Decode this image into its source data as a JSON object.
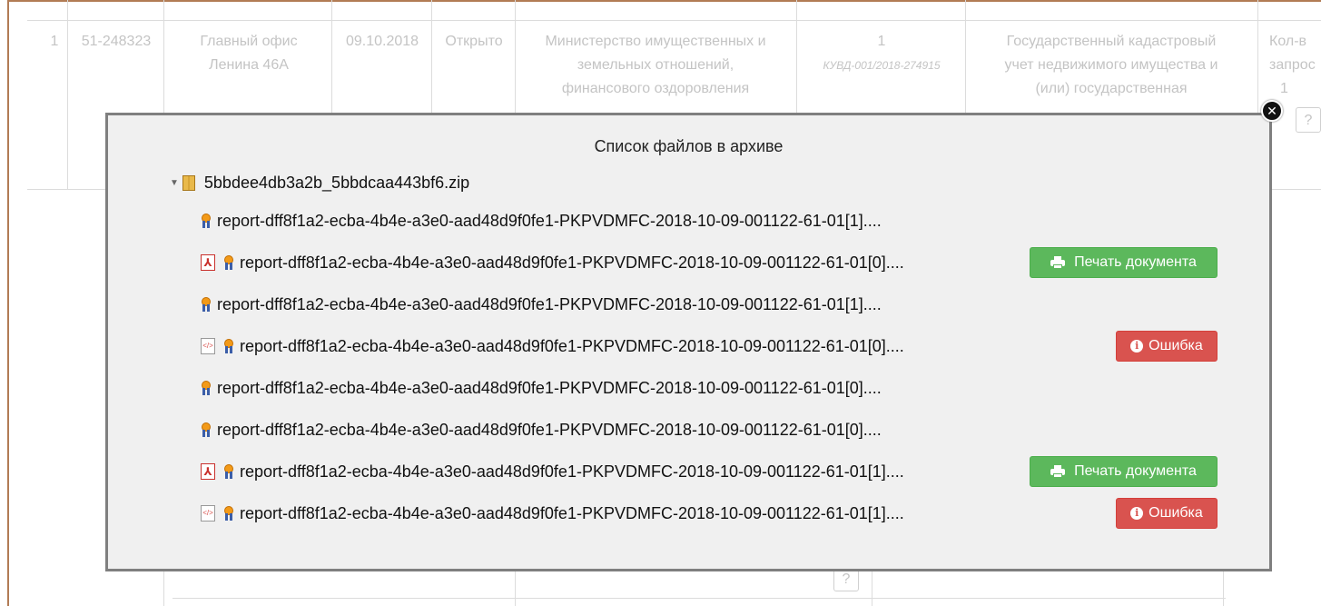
{
  "background_table": {
    "row_num": "1",
    "number": "51-248323",
    "office_line1": "Главный офис",
    "office_line2": "Ленина 46А",
    "date": "09.10.2018",
    "status": "Открыто",
    "org_line1": "Министерство имущественных и",
    "org_line2": "земельных отношений,",
    "org_line3": "финансового оздоровления",
    "count": "1",
    "kuvd": "КУВД-001/2018-274915",
    "service_line1": "Государственный кадастровый",
    "service_line2": "учет недвижимого имущества и",
    "service_line3": "(или) государственная",
    "extra_line1": "Кол-в",
    "extra_line2": "запрос",
    "extra_line3": "1",
    "help_mark": "?"
  },
  "modal": {
    "title": "Список файлов в архиве",
    "close_label": "✕",
    "archive_name": "5bbdee4db3a2b_5bbdcaa443bf6.zip",
    "files": [
      {
        "name": "report-dff8f1a2-ecba-4b4e-a3e0-aad48d9f0fe1-PKPVDMFC-2018-10-09-001122-61-01[1]....",
        "file_icon": "",
        "action": ""
      },
      {
        "name": "report-dff8f1a2-ecba-4b4e-a3e0-aad48d9f0fe1-PKPVDMFC-2018-10-09-001122-61-01[0]....",
        "file_icon": "pdf-icon",
        "action": "print"
      },
      {
        "name": "report-dff8f1a2-ecba-4b4e-a3e0-aad48d9f0fe1-PKPVDMFC-2018-10-09-001122-61-01[1]....",
        "file_icon": "",
        "action": ""
      },
      {
        "name": "report-dff8f1a2-ecba-4b4e-a3e0-aad48d9f0fe1-PKPVDMFC-2018-10-09-001122-61-01[0]....",
        "file_icon": "xml-icon",
        "action": "error"
      },
      {
        "name": "report-dff8f1a2-ecba-4b4e-a3e0-aad48d9f0fe1-PKPVDMFC-2018-10-09-001122-61-01[0]....",
        "file_icon": "",
        "action": ""
      },
      {
        "name": "report-dff8f1a2-ecba-4b4e-a3e0-aad48d9f0fe1-PKPVDMFC-2018-10-09-001122-61-01[0]....",
        "file_icon": "",
        "action": ""
      },
      {
        "name": "report-dff8f1a2-ecba-4b4e-a3e0-aad48d9f0fe1-PKPVDMFC-2018-10-09-001122-61-01[1]....",
        "file_icon": "pdf-icon",
        "action": "print"
      },
      {
        "name": "report-dff8f1a2-ecba-4b4e-a3e0-aad48d9f0fe1-PKPVDMFC-2018-10-09-001122-61-01[1]....",
        "file_icon": "xml-icon",
        "action": "error"
      }
    ],
    "print_label": "Печать документа",
    "error_label": "Ошибка"
  },
  "colors": {
    "print_button": "#5cb85c",
    "error_button": "#d9534f",
    "modal_border": "#7f7f7f",
    "frame": "#b27c55"
  }
}
